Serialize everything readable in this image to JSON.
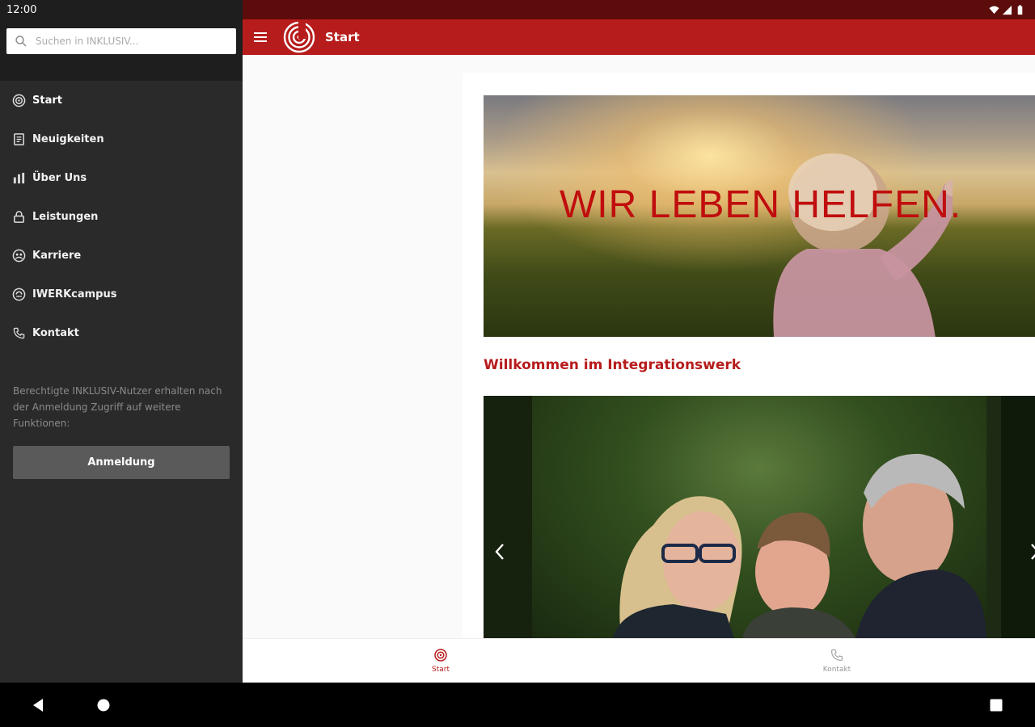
{
  "status": {
    "time": "12:00"
  },
  "drawer": {
    "search_placeholder": "Suchen in INKLUSIV...",
    "items": [
      {
        "label": "Start",
        "icon": "start-logo-icon"
      },
      {
        "label": "Neuigkeiten",
        "icon": "news-icon"
      },
      {
        "label": "Über Uns",
        "icon": "org-chart-icon"
      },
      {
        "label": "Leistungen",
        "icon": "lock-icon"
      },
      {
        "label": "Karriere",
        "icon": "career-icon"
      },
      {
        "label": "IWERKcampus",
        "icon": "campus-icon"
      },
      {
        "label": "Kontakt",
        "icon": "phone-icon"
      }
    ],
    "note": "Berechtigte INKLUSIV-Nutzer erhalten nach der Anmeldung Zugriff auf weitere Funktionen:",
    "login_label": "Anmeldung"
  },
  "appbar": {
    "title": "Start"
  },
  "hero": {
    "headline": "WIR LEBEN HELFEN."
  },
  "main": {
    "welcome": "Willkommen im Integrationswerk"
  },
  "bottom_nav": {
    "items": [
      {
        "label": "Start",
        "active": true
      },
      {
        "label": "Kontakt",
        "active": false
      }
    ]
  },
  "colors": {
    "brand_red": "#b71c1c",
    "status_dark_red": "#5d0c0c",
    "drawer_bg": "#2a2a2a"
  }
}
